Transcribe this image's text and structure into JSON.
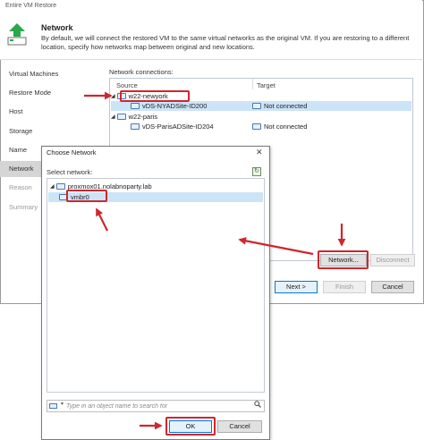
{
  "window": {
    "title": "Entire VM Restore"
  },
  "header": {
    "title": "Network",
    "description": "By default, we will connect the restored VM to the same virtual networks as the original VM. If you are restoring to a different location, specify how networks map between original and new locations."
  },
  "sidebar": {
    "items": [
      {
        "label": "Virtual Machines",
        "state": "enabled"
      },
      {
        "label": "Restore Mode",
        "state": "enabled"
      },
      {
        "label": "Host",
        "state": "enabled"
      },
      {
        "label": "Storage",
        "state": "enabled"
      },
      {
        "label": "Name",
        "state": "enabled"
      },
      {
        "label": "Network",
        "state": "active"
      },
      {
        "label": "Reason",
        "state": "disabled"
      },
      {
        "label": "Summary",
        "state": "disabled"
      }
    ]
  },
  "network_connections": {
    "label": "Network connections:",
    "columns": {
      "source": "Source",
      "target": "Target"
    },
    "rows": [
      {
        "kind": "host",
        "source": "w22-newyork",
        "target": ""
      },
      {
        "kind": "network",
        "source": "vDS-NYADSite-ID200",
        "target": "Not connected",
        "selected": true
      },
      {
        "kind": "host",
        "source": "w22-paris",
        "target": ""
      },
      {
        "kind": "network",
        "source": "vDS-ParisADSite-ID204",
        "target": "Not connected",
        "selected": false
      }
    ]
  },
  "wizard_buttons": {
    "network": "Network...",
    "disconnect": "Disconnect",
    "next": "Next >",
    "finish": "Finish",
    "cancel": "Cancel"
  },
  "choose_network": {
    "title": "Choose Network",
    "close_glyph": "✕",
    "select_label": "Select network:",
    "tree": {
      "host": "proxmox01.nolabnoparty.lab",
      "network": "vmbr0"
    },
    "search_placeholder": "Type in an object name to search for",
    "ok": "OK",
    "cancel": "Cancel"
  },
  "colors": {
    "highlight": "#d0262d",
    "selection": "#cce4f7",
    "active_sidebar": "#d5d5d5",
    "icon_green": "#2ca84a"
  }
}
